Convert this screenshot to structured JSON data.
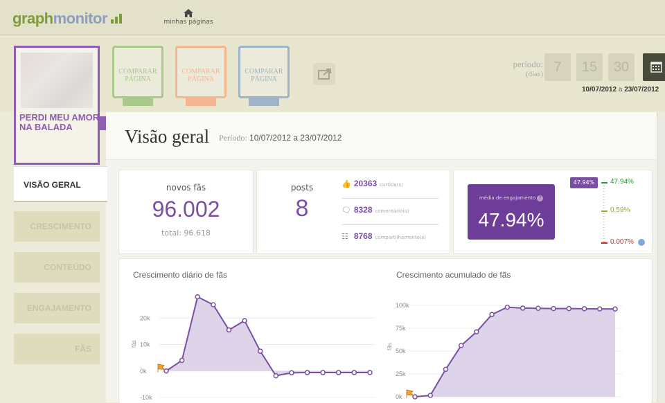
{
  "header": {
    "logo_part1": "graph",
    "logo_part2": "monitor",
    "home_label": "minhas páginas"
  },
  "page_cover": {
    "title": "PERDI MEU AMOR NA BALADA"
  },
  "compare_buttons": [
    {
      "label": "COMPARAR PÁGINA",
      "color": "#a9c98a"
    },
    {
      "label": "COMPARAR PÁGINA",
      "color": "#f4b592"
    },
    {
      "label": "COMPARAR PÁGINA",
      "color": "#9fb3c9"
    }
  ],
  "period_selector": {
    "label": "período:",
    "sublabel": "(dias)",
    "options": [
      "7",
      "15",
      "30"
    ],
    "range_start": "10/07/2012",
    "range_sep": "a",
    "range_end": "23/07/2012"
  },
  "main": {
    "title": "Visão geral",
    "period_label": "Período:",
    "period_value": "10/07/2012 a 23/07/2012"
  },
  "nav": [
    {
      "label": "VISÃO GERAL",
      "active": true
    },
    {
      "label": "CRESCIMENTO",
      "active": false
    },
    {
      "label": "CONTEÚDO",
      "active": false
    },
    {
      "label": "ENGAJAMENTO",
      "active": false
    },
    {
      "label": "FÃS",
      "active": false
    }
  ],
  "stats": {
    "novos_fas_label": "novos fãs",
    "novos_fas_value": "96.002",
    "total_label": "total: 96.618",
    "posts_label": "posts",
    "posts_value": "8",
    "curtidas_value": "20363",
    "curtidas_label": "curtida(s)",
    "comentarios_value": "8328",
    "comentarios_label": "comentário(s)",
    "compart_value": "8768",
    "compart_label": "compartilhamento(s)"
  },
  "engagement": {
    "label": "média de engajamento",
    "help": "?",
    "value": "47.94%",
    "marker": "47.94%",
    "scale_top": "47.94%",
    "scale_mid": "0.59%",
    "scale_bottom": "0.007%",
    "colors": {
      "top": "#2e9a2e",
      "mid": "#8ab32b",
      "bottom": "#c0302e"
    }
  },
  "chart_data": [
    {
      "type": "area",
      "title": "Crescimento diário de fãs",
      "xlabel": "",
      "ylabel": "fãs",
      "y_ticks": [
        "20k",
        "10k",
        "0k",
        "-10k"
      ],
      "ylim": [
        -10000,
        30000
      ],
      "x": [
        1,
        2,
        3,
        4,
        5,
        6,
        7,
        8,
        9,
        10,
        11,
        12,
        13,
        14
      ],
      "values": [
        0,
        4000,
        28000,
        25000,
        15500,
        19000,
        7500,
        -1800,
        -700,
        -600,
        -600,
        -600,
        -600,
        -600
      ],
      "color": "#7a4ea3",
      "grid": true
    },
    {
      "type": "area",
      "title": "Crescimento acumulado de fãs",
      "xlabel": "",
      "ylabel": "fãs",
      "y_ticks": [
        "100k",
        "75k",
        "50k",
        "25k",
        "0k"
      ],
      "ylim": [
        0,
        100000
      ],
      "x": [
        1,
        2,
        3,
        4,
        5,
        6,
        7,
        8,
        9,
        10,
        11,
        12,
        13,
        14
      ],
      "values": [
        0,
        1500,
        30000,
        56000,
        71000,
        90000,
        98000,
        97000,
        96800,
        96500,
        96500,
        96300,
        96100,
        96000
      ],
      "color": "#7a4ea3",
      "grid": true
    }
  ]
}
